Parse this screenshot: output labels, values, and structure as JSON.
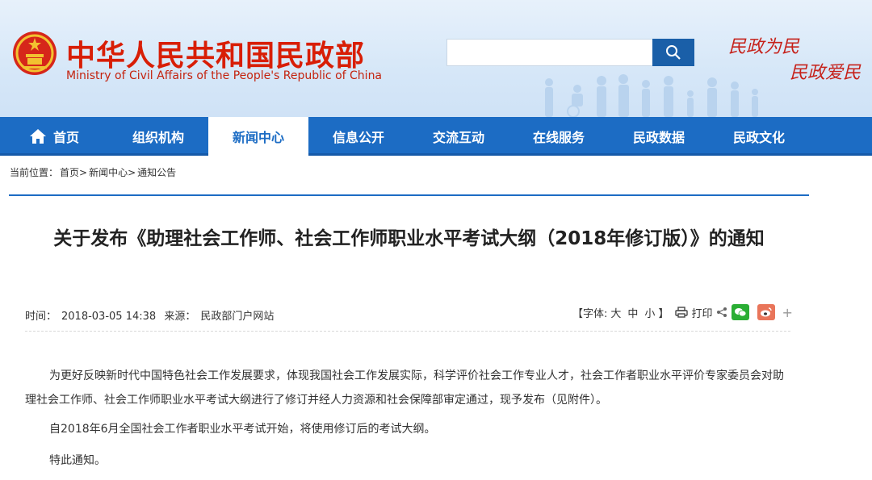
{
  "header": {
    "site_name_cn": "中华人民共和国民政部",
    "site_name_en": "Ministry of Civil Affairs of the People's Republic of China",
    "search_placeholder": "",
    "slogan_line1": "民政为民",
    "slogan_line2": "民政爱民"
  },
  "nav": {
    "items": [
      {
        "label": "首页"
      },
      {
        "label": "组织机构"
      },
      {
        "label": "新闻中心"
      },
      {
        "label": "信息公开"
      },
      {
        "label": "交流互动"
      },
      {
        "label": "在线服务"
      },
      {
        "label": "民政数据"
      },
      {
        "label": "民政文化"
      }
    ],
    "active_index": 2
  },
  "breadcrumb": {
    "prefix": "当前位置：",
    "items": [
      "首页>",
      "新闻中心>",
      "通知公告"
    ]
  },
  "article": {
    "title": "关于发布《助理社会工作师、社会工作师职业水平考试大纲（2018年修订版）》的通知",
    "time_label": "时间：",
    "time": "2018-03-05 14:38",
    "source_label": "来源：",
    "source": "民政部门户网站",
    "font_label_open": "【字体:",
    "font_large": "大",
    "font_medium": "中",
    "font_small": "小",
    "font_label_close": "】",
    "print_label": "打印",
    "plus": "+",
    "paragraphs": [
      "为更好反映新时代中国特色社会工作发展要求，体现我国社会工作发展实际，科学评价社会工作专业人才，社会工作者职业水平评价专家委员会对助理社会工作师、社会工作师职业水平考试大纲进行了修订并经人力资源和社会保障部审定通过，现予发布（见附件）。",
      "自2018年6月全国社会工作者职业水平考试开始，将使用修订后的考试大纲。",
      "特此通知。"
    ]
  },
  "colors": {
    "brand_red": "#d81e06",
    "nav_blue": "#1c6cc4",
    "wechat_green": "#2aae34",
    "weibo_orange": "#e9755a"
  }
}
